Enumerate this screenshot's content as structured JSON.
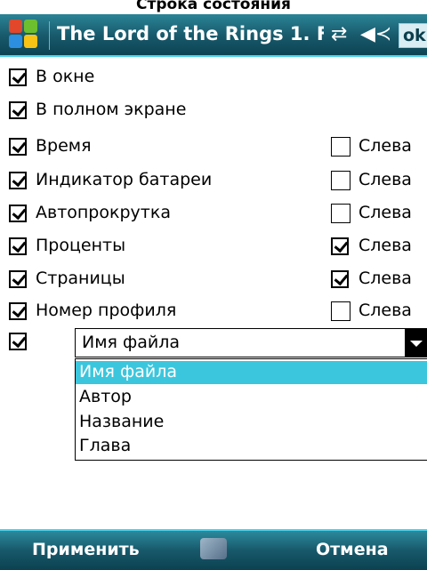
{
  "header": {
    "caption": "Строка состояния"
  },
  "titlebar": {
    "title": "The Lord of the Rings 1. F",
    "ok_label": "ok",
    "icons": [
      "windows-start-icon",
      "connectivity-icon",
      "volume-icon"
    ],
    "colors": {
      "bar": "#17586a",
      "accent": "#4bd2ec"
    }
  },
  "mode": [
    {
      "label": "В окне",
      "checked": true
    },
    {
      "label": "В полном экране",
      "checked": true
    }
  ],
  "items": [
    {
      "label": "Время",
      "checked": true,
      "left_label": "Слева",
      "left_checked": false
    },
    {
      "label": "Индикатор батареи",
      "checked": true,
      "left_label": "Слева",
      "left_checked": false
    },
    {
      "label": "Автопрокрутка",
      "checked": true,
      "left_label": "Слева",
      "left_checked": false
    },
    {
      "label": "Проценты",
      "checked": true,
      "left_label": "Слева",
      "left_checked": true
    },
    {
      "label": "Страницы",
      "checked": true,
      "left_label": "Слева",
      "left_checked": true
    },
    {
      "label": "Номер профиля",
      "checked": true,
      "left_label": "Слева",
      "left_checked": false
    }
  ],
  "file_row": {
    "checked": true,
    "selected": "Имя файла",
    "options": [
      "Имя файла",
      "Автор",
      "Название",
      "Глава"
    ],
    "highlight_color": "#3cc6dd"
  },
  "softkeys": {
    "left": "Применить",
    "right": "Отмена",
    "center_icon": "keyboard-icon"
  }
}
